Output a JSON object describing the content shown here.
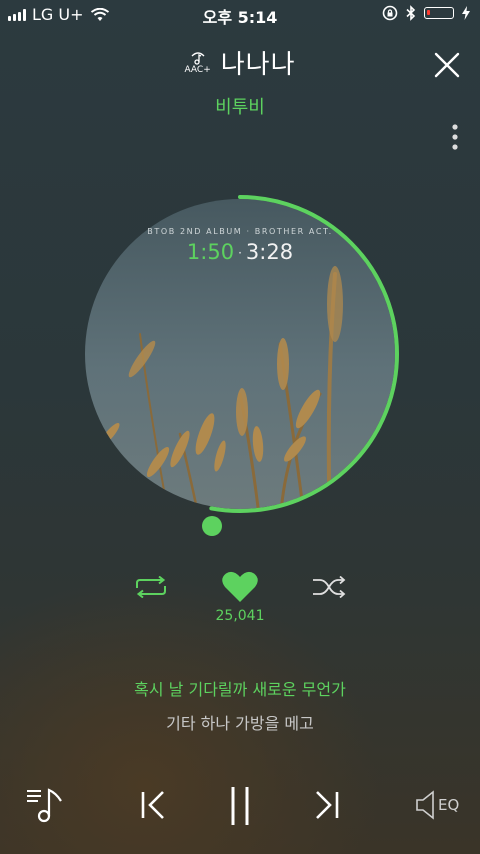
{
  "status_bar": {
    "carrier": "LG U+",
    "time": "오후 5:14",
    "battery_level": 0.15
  },
  "header": {
    "quality_badge": "AAC+",
    "song_title": "나나나",
    "artist": "비투비"
  },
  "player": {
    "album_title": "BTOB 2ND ALBUM · BROTHER ACT.",
    "current_time": "1:50",
    "separator": "·",
    "total_time": "3:28",
    "progress": 0.529
  },
  "actions": {
    "like_count": "25,041"
  },
  "lyrics": {
    "current": "혹시 날 기다릴까 새로운 무언가",
    "next": "기타 하나 가방을 메고"
  },
  "bottom_bar": {
    "eq_label": "EQ"
  },
  "colors": {
    "accent": "#5dd25f",
    "background": "#2c3a3f"
  },
  "icons": [
    "wifi-icon",
    "rotation-lock-icon",
    "bluetooth-icon",
    "charging-icon",
    "music-note-icon",
    "close-icon",
    "more-vertical-icon",
    "repeat-icon",
    "heart-icon",
    "shuffle-icon",
    "playlist-icon",
    "previous-icon",
    "pause-icon",
    "next-icon",
    "speaker-eq-icon"
  ]
}
